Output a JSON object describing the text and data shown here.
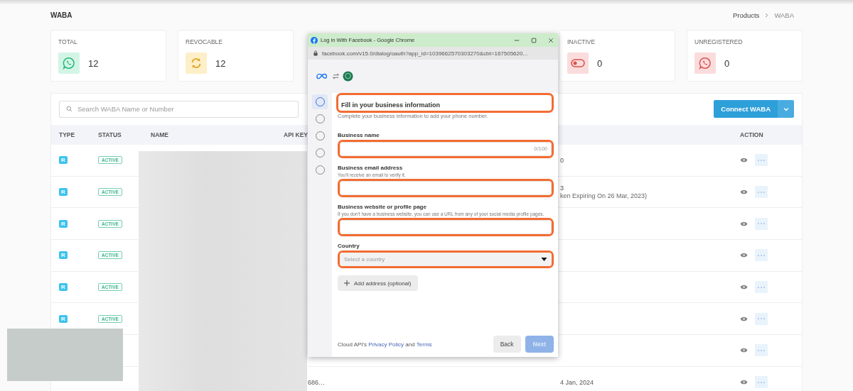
{
  "page": {
    "title": "WABA",
    "breadcrumb": [
      {
        "label": "Products"
      },
      {
        "label": "WABA"
      }
    ]
  },
  "stats": [
    {
      "label": "TOTAL",
      "value": "12",
      "kind": "total"
    },
    {
      "label": "REVOCABLE",
      "value": "12",
      "kind": "revocable"
    },
    {
      "label": "INACTIVE",
      "value": "0",
      "kind": "inactive"
    },
    {
      "label": "UNREGISTERED",
      "value": "0",
      "kind": "unregistered"
    }
  ],
  "table": {
    "search": {
      "placeholder": "Search WABA Name or Number"
    },
    "connect_button": "Connect WABA",
    "columns": [
      "TYPE",
      "STATUS",
      "NAME",
      "API KEY",
      "ACTION"
    ],
    "rows": [
      {
        "type": "R",
        "status": "ACTIVE",
        "column_5": "0"
      },
      {
        "type": "R",
        "status": "ACTIVE",
        "column_5": "3",
        "column_5_note": "ken Expiring On 26 Mar, 2023)"
      },
      {
        "type": "R",
        "status": "ACTIVE"
      },
      {
        "type": "R",
        "status": "ACTIVE"
      },
      {
        "type": "R",
        "status": "ACTIVE"
      },
      {
        "type": "R",
        "status": "ACTIVE"
      },
      {},
      {
        "api_key": "686…",
        "column_5": "4 Jan, 2024"
      }
    ]
  },
  "popup": {
    "title": "Log in With Facebook - Google Chrome",
    "url": "facebook.com/v15.0/dialog/oauth?app_id=1039662570303270&cbt=167505620...",
    "steps": [
      {
        "selected": true
      },
      {
        "selected": false
      },
      {
        "selected": false
      },
      {
        "selected": false
      },
      {
        "selected": false
      }
    ],
    "heading": "Fill in your business information",
    "heading_highlighted": true,
    "subtitle": "Complete your business information to add your phone number.",
    "fields": [
      {
        "kind": "text",
        "label": "Business name",
        "counter": "0/100",
        "highlighted": true
      },
      {
        "kind": "text",
        "label": "Business email address",
        "hint": "You'll receive an email to verify it.",
        "highlighted": true
      },
      {
        "kind": "text",
        "label": "Business website or profile page",
        "hint": "If you don't have a business website, you can use a URL from any of your social media profile pages.",
        "highlighted": true
      },
      {
        "kind": "select",
        "label": "Country",
        "placeholder": "Select a country",
        "highlighted": true
      }
    ],
    "add_address": "Add address (optional)",
    "footer": {
      "prefix": "Cloud API's",
      "link_1": "Privacy Policy",
      "middle": "and",
      "link_2": "Terms"
    },
    "back_button": "Back",
    "next_button": {
      "label": "Next",
      "disabled": true
    }
  }
}
